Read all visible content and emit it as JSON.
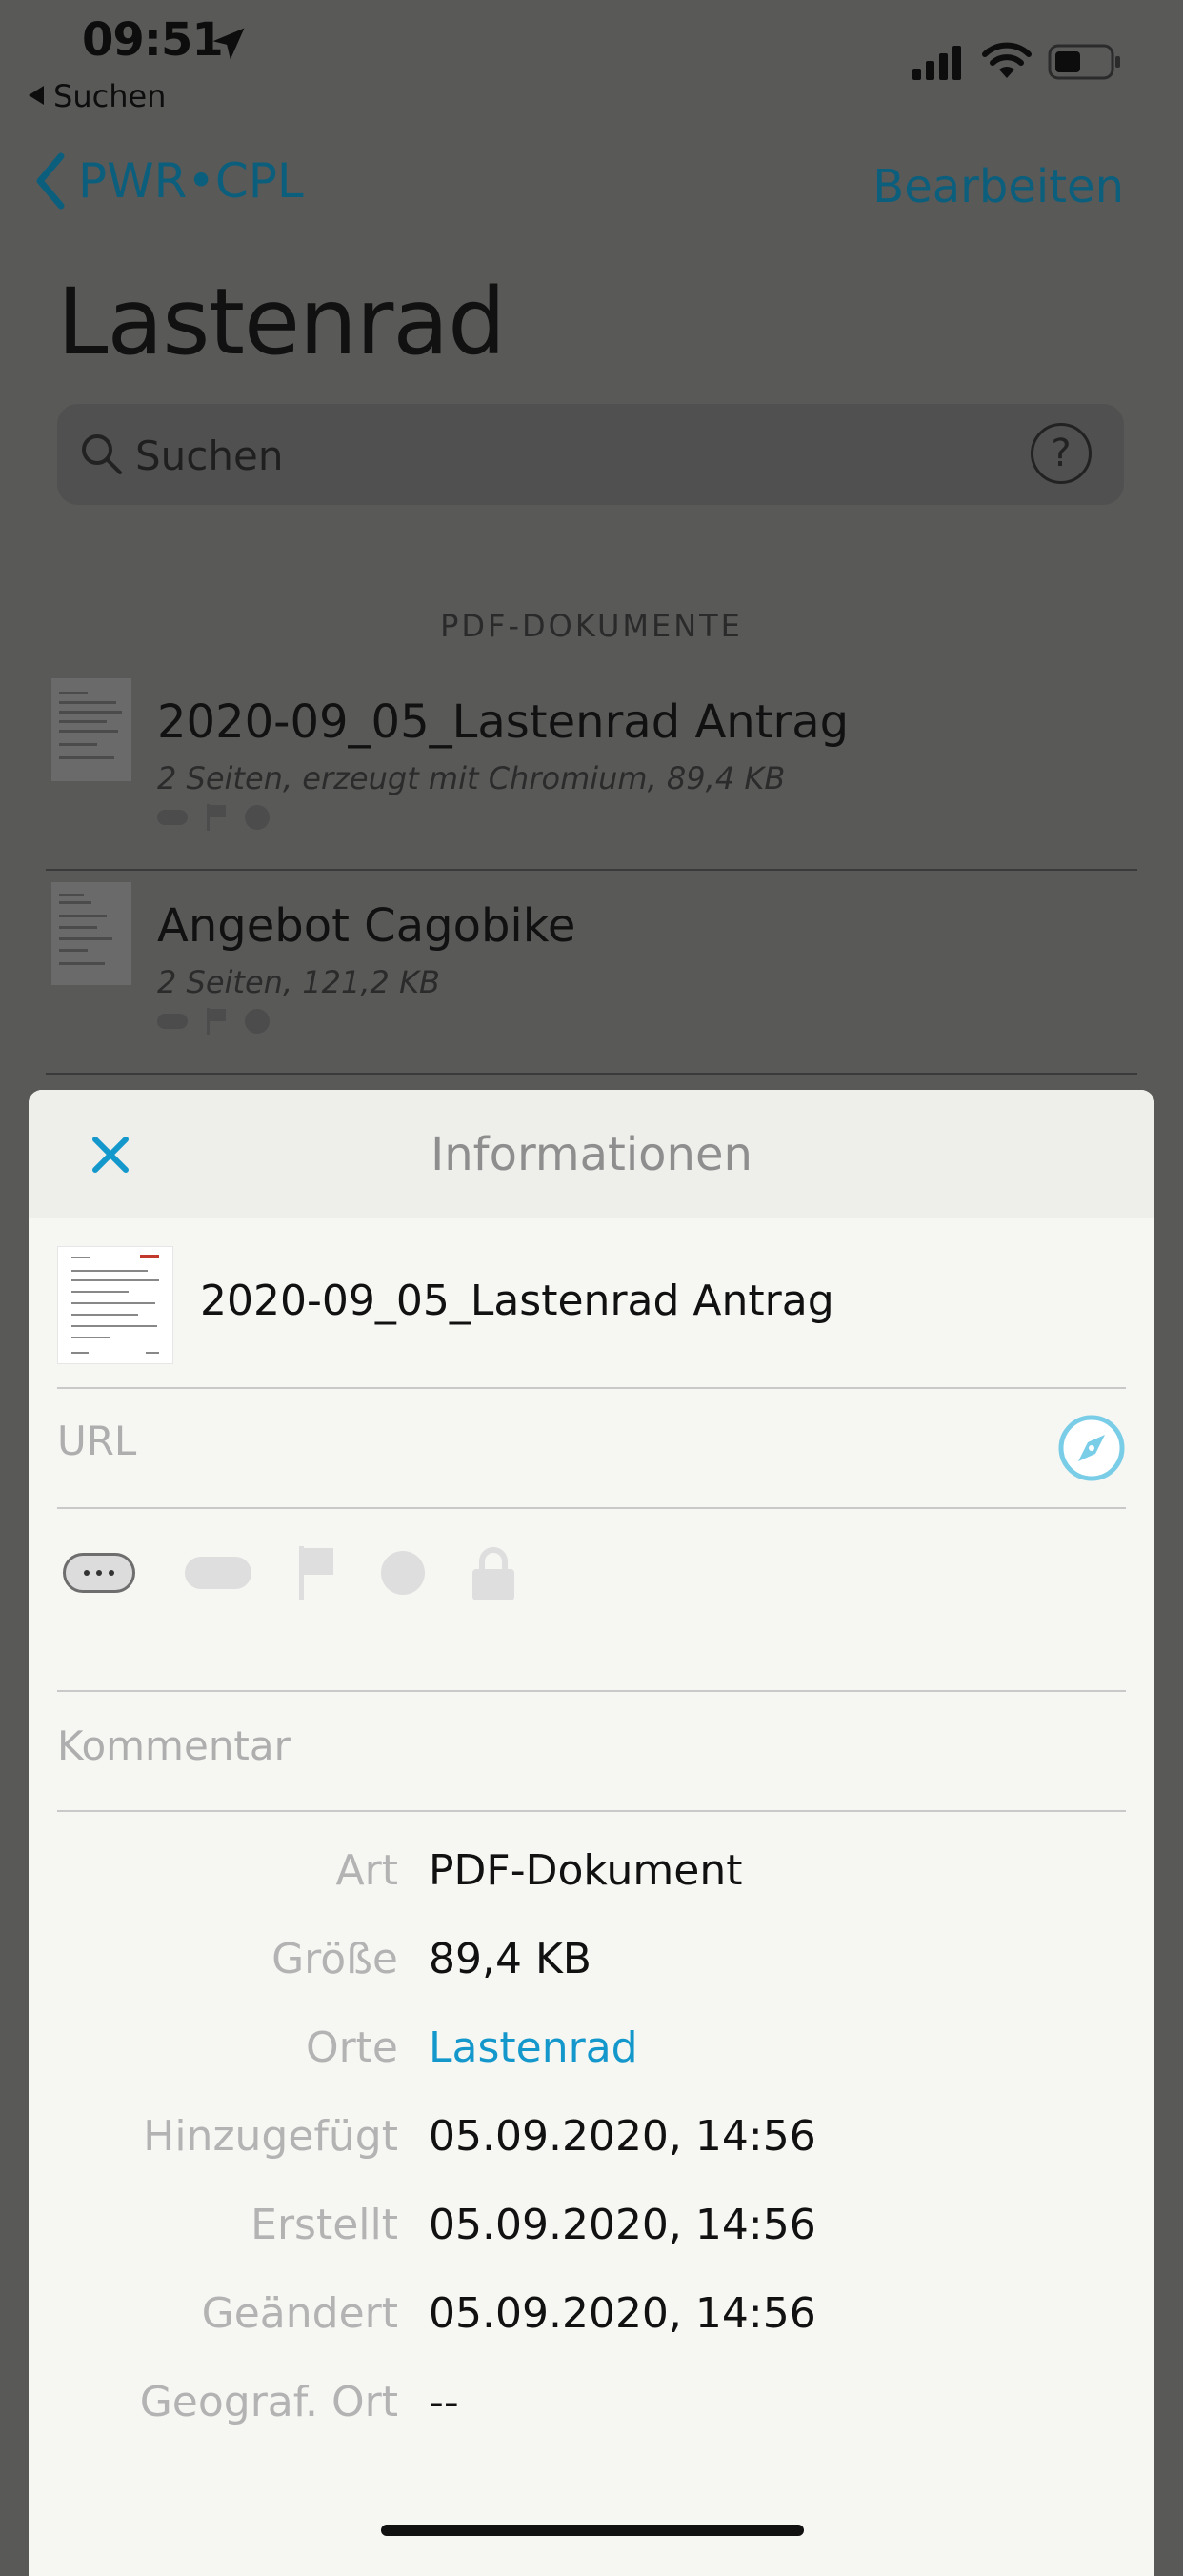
{
  "status_bar": {
    "time": "09:51",
    "back_app_label": "Suchen"
  },
  "nav": {
    "back_label": "PWR•CPL",
    "edit_label": "Bearbeiten",
    "title": "Lastenrad"
  },
  "search": {
    "placeholder": "Suchen",
    "help_glyph": "?"
  },
  "list": {
    "section_header": "PDF-DOKUMENTE",
    "items": [
      {
        "title": "2020-09_05_Lastenrad Antrag",
        "meta": "2 Seiten, erzeugt mit Chromium, 89,4 KB"
      },
      {
        "title": "Angebot Cagobike",
        "meta": "2 Seiten, 121,2 KB"
      }
    ]
  },
  "sheet": {
    "title": "Informationen",
    "file_name": "2020-09_05_Lastenrad Antrag",
    "url_placeholder": "URL",
    "comment_placeholder": "Kommentar",
    "info": [
      {
        "label": "Art",
        "value": "PDF-Dokument"
      },
      {
        "label": "Größe",
        "value": "89,4 KB"
      },
      {
        "label": "Orte",
        "value": "Lastenrad"
      },
      {
        "label": "Hinzugefügt",
        "value": "05.09.2020, 14:56"
      },
      {
        "label": "Erstellt",
        "value": "05.09.2020, 14:56"
      },
      {
        "label": "Geändert",
        "value": "05.09.2020, 14:56"
      },
      {
        "label": "Geograf. Ort",
        "value": "--"
      }
    ]
  },
  "colors": {
    "accent": "#1498cc",
    "dimmed_accent": "#0c5f7c",
    "overlay_background": "#595958",
    "sheet_background": "#f6f6f3"
  },
  "icons": [
    "location-arrow-icon",
    "signal-icon",
    "wifi-icon",
    "battery-icon",
    "chevron-left-icon",
    "search-icon",
    "help-icon",
    "close-icon",
    "compass-icon",
    "more-icon",
    "tag-icon",
    "flag-icon",
    "label-dot-icon",
    "lock-icon"
  ]
}
